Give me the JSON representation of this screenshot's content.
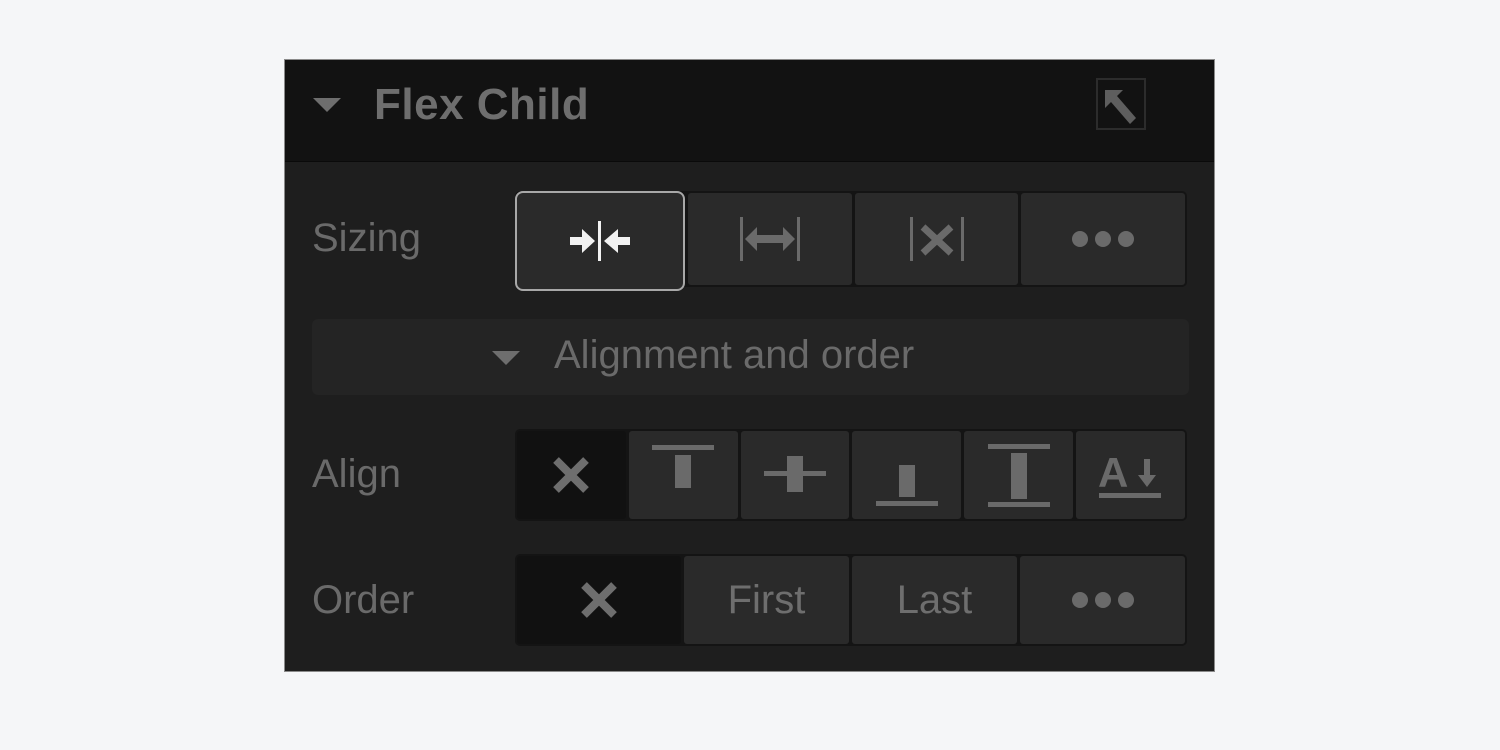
{
  "panel": {
    "title": "Flex Child",
    "header_icon": "arrow-up-left-icon"
  },
  "sizing": {
    "label": "Sizing",
    "options": [
      {
        "name": "shrink-if-needed",
        "icon": "shrink-icon",
        "selected": true
      },
      {
        "name": "grow-if-possible",
        "icon": "grow-icon",
        "selected": false
      },
      {
        "name": "dont-shrink-or-grow",
        "icon": "no-resize-icon",
        "selected": false
      },
      {
        "name": "more-options",
        "icon": "more-icon",
        "selected": false
      }
    ]
  },
  "alignment_section": {
    "label": "Alignment and order"
  },
  "align": {
    "label": "Align",
    "options": [
      {
        "name": "none",
        "icon": "x-icon",
        "selected": true
      },
      {
        "name": "start",
        "icon": "align-top-icon"
      },
      {
        "name": "center",
        "icon": "align-center-icon"
      },
      {
        "name": "end",
        "icon": "align-bottom-icon"
      },
      {
        "name": "stretch",
        "icon": "align-stretch-icon"
      },
      {
        "name": "baseline",
        "icon": "align-baseline-icon"
      }
    ]
  },
  "order": {
    "label": "Order",
    "options": [
      {
        "name": "none",
        "icon": "x-icon",
        "selected": true
      },
      {
        "name": "first",
        "label": "First"
      },
      {
        "name": "last",
        "label": "Last"
      },
      {
        "name": "more",
        "icon": "more-icon"
      }
    ],
    "first_label": "First",
    "last_label": "Last"
  },
  "colors": {
    "panel_bg": "#1e1e1e",
    "header_bg": "#121212",
    "button_bg": "#2a2a2a",
    "text_muted": "#6e6e6e",
    "selected_border": "#a8a8a8",
    "page_bg": "#f5f6f8"
  }
}
